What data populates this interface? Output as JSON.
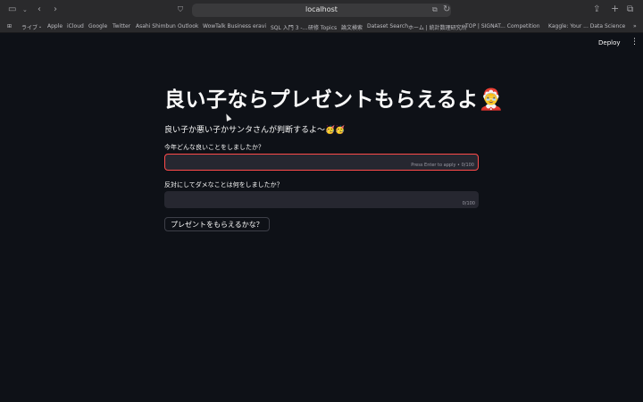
{
  "browser": {
    "url": "localhost",
    "bookmarks": [
      "ライブ・",
      "Apple",
      "iCloud",
      "Google",
      "Twitter",
      "Asahi Shimbun",
      "Outlook",
      "WowTalk Business",
      "eravi",
      "SQL 入門 3 -...",
      "研修 Topics",
      "論文検索",
      "Dataset Search",
      "ホーム | 統計数理研究所",
      "TOP | SIGNAT... Competition",
      "Kaggle: Your ... Data Science"
    ]
  },
  "app": {
    "deploy_label": "Deploy",
    "title": "良い子ならプレゼントもらえるよ🤶",
    "subtitle": "良い子か悪い子かサンタさんが判断するよ〜🥳🥳",
    "q1": {
      "label": "今年どんな良いことをしましたか？",
      "value": "",
      "hint": "Press Enter to apply",
      "counter": "0/100"
    },
    "q2": {
      "label": "反対にしてダメなことは何をしましたか？",
      "value": "",
      "counter": "0/100"
    },
    "submit_label": "プレゼントをもらえるかな？"
  }
}
